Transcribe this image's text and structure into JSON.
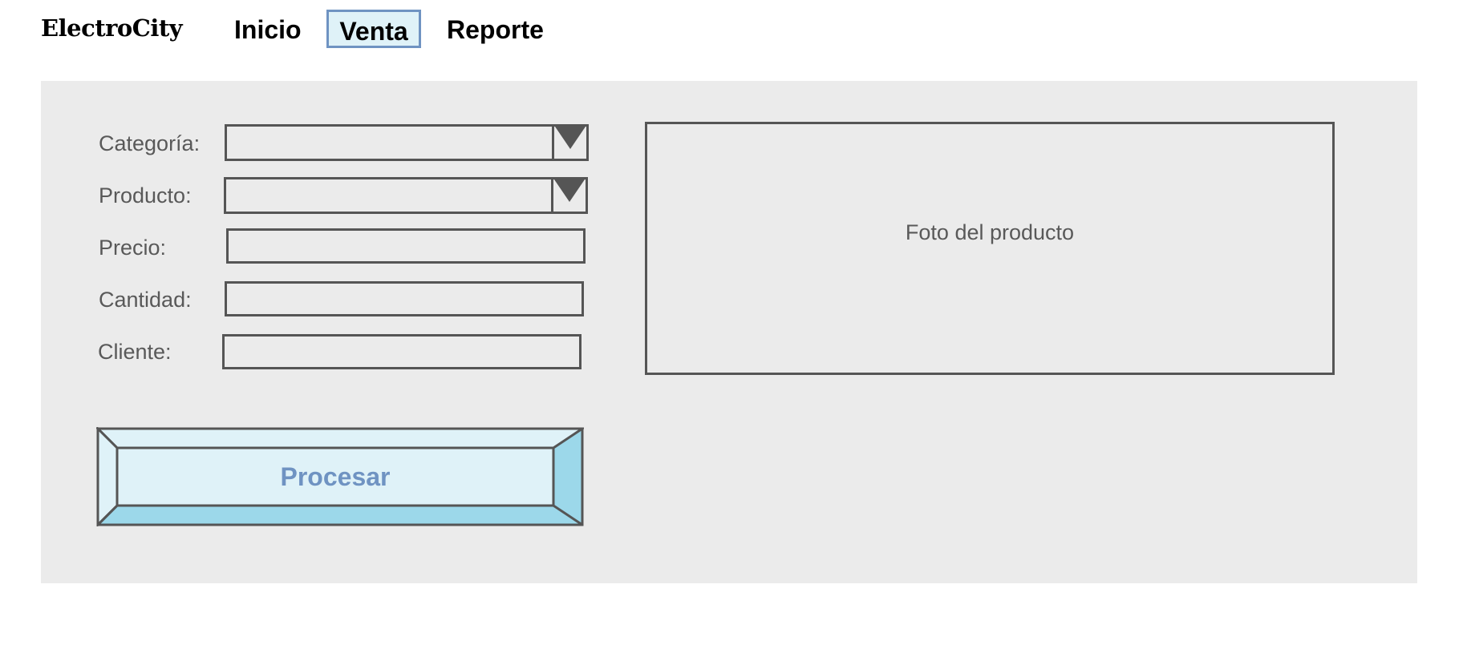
{
  "app": {
    "brand": "ElectroCity"
  },
  "nav": {
    "items": [
      {
        "label": "Inicio",
        "active": false
      },
      {
        "label": "Venta",
        "active": true
      },
      {
        "label": "Reporte",
        "active": false
      }
    ]
  },
  "form": {
    "categoria": {
      "label": "Categoría:",
      "value": ""
    },
    "producto": {
      "label": "Producto:",
      "value": ""
    },
    "precio": {
      "label": "Precio:",
      "value": ""
    },
    "cantidad": {
      "label": "Cantidad:",
      "value": ""
    },
    "cliente": {
      "label": "Cliente:",
      "value": ""
    },
    "submit_label": "Procesar"
  },
  "photo": {
    "label": "Foto del producto"
  },
  "colors": {
    "accent": "#6f93c2",
    "active_tab_bg": "#dff2f8",
    "button_face": "#dff2f8",
    "button_bevel": "#9cd8ea",
    "panel_bg": "#ebebeb",
    "border": "#555555",
    "label_text": "#595959"
  },
  "icons": {
    "combo_arrow": "chevron-down-icon"
  }
}
